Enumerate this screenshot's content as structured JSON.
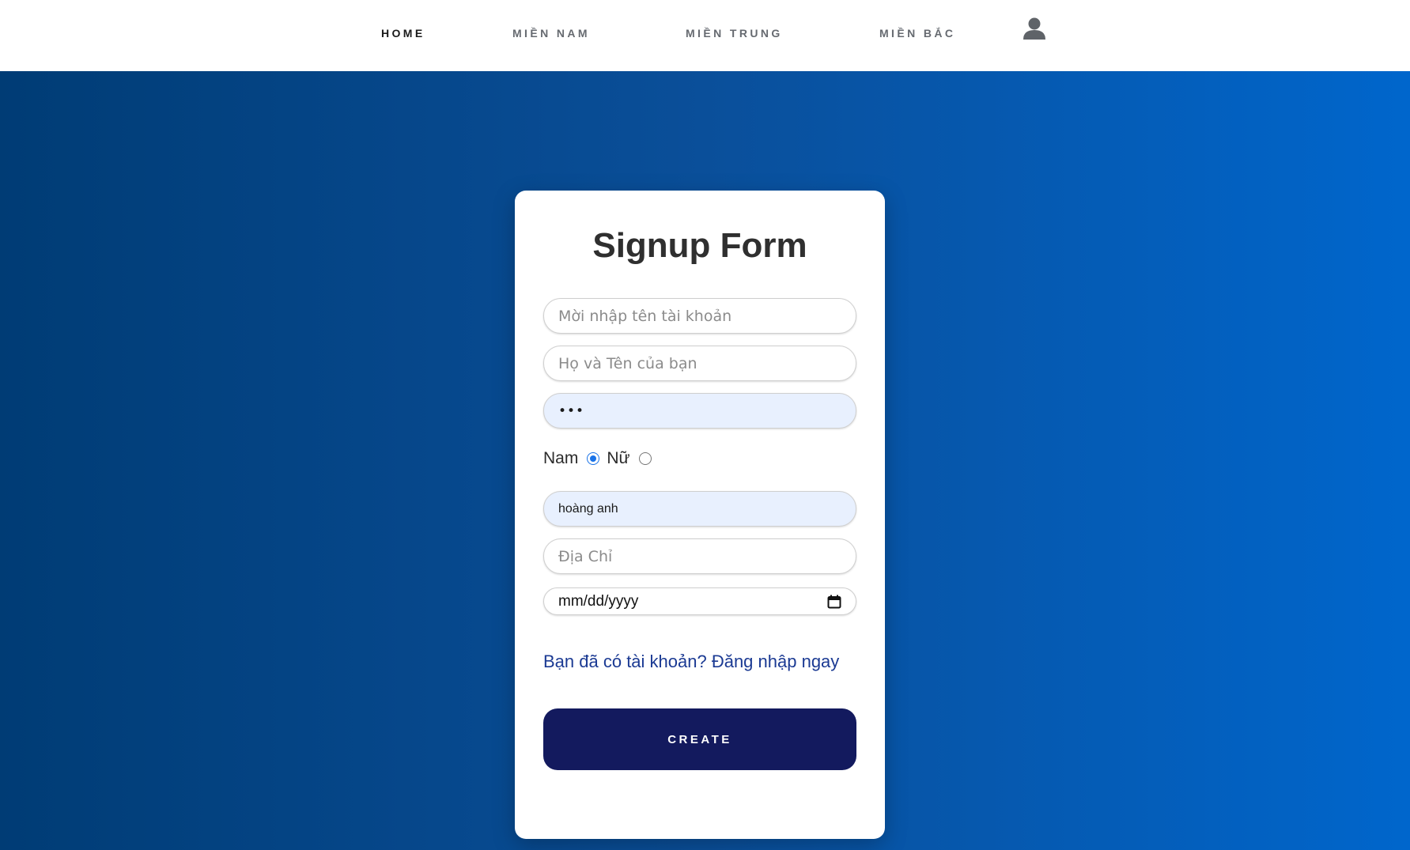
{
  "nav": {
    "items": [
      {
        "label": "HOME",
        "active": true
      },
      {
        "label": "MIỀN NAM",
        "active": false
      },
      {
        "label": "MIỀN TRUNG",
        "active": false
      },
      {
        "label": "MIỀN BẮC",
        "active": false
      }
    ],
    "user_icon": "user-icon"
  },
  "form": {
    "title": "Signup Form",
    "username": {
      "placeholder": "Mời nhập tên tài khoản",
      "value": ""
    },
    "fullname": {
      "placeholder": "Họ và Tên của bạn",
      "value": ""
    },
    "password": {
      "value": "•••"
    },
    "gender": {
      "options": [
        "Nam",
        "Nữ"
      ],
      "selected": "Nam"
    },
    "name_field": {
      "value": "hoàng anh"
    },
    "address": {
      "placeholder": "Địa Chỉ",
      "value": ""
    },
    "birthdate": {
      "placeholder": "mm/dd/yyyy",
      "icon": "calendar-icon"
    },
    "login_link": "Bạn đã có tài khoản? Đăng nhập ngay",
    "create_label": "CREATE"
  },
  "colors": {
    "background_start": "#003c75",
    "background_end": "#0066cc",
    "button": "#131a5e",
    "link": "#1b3a93",
    "radio_selected": "#1a73e8"
  }
}
